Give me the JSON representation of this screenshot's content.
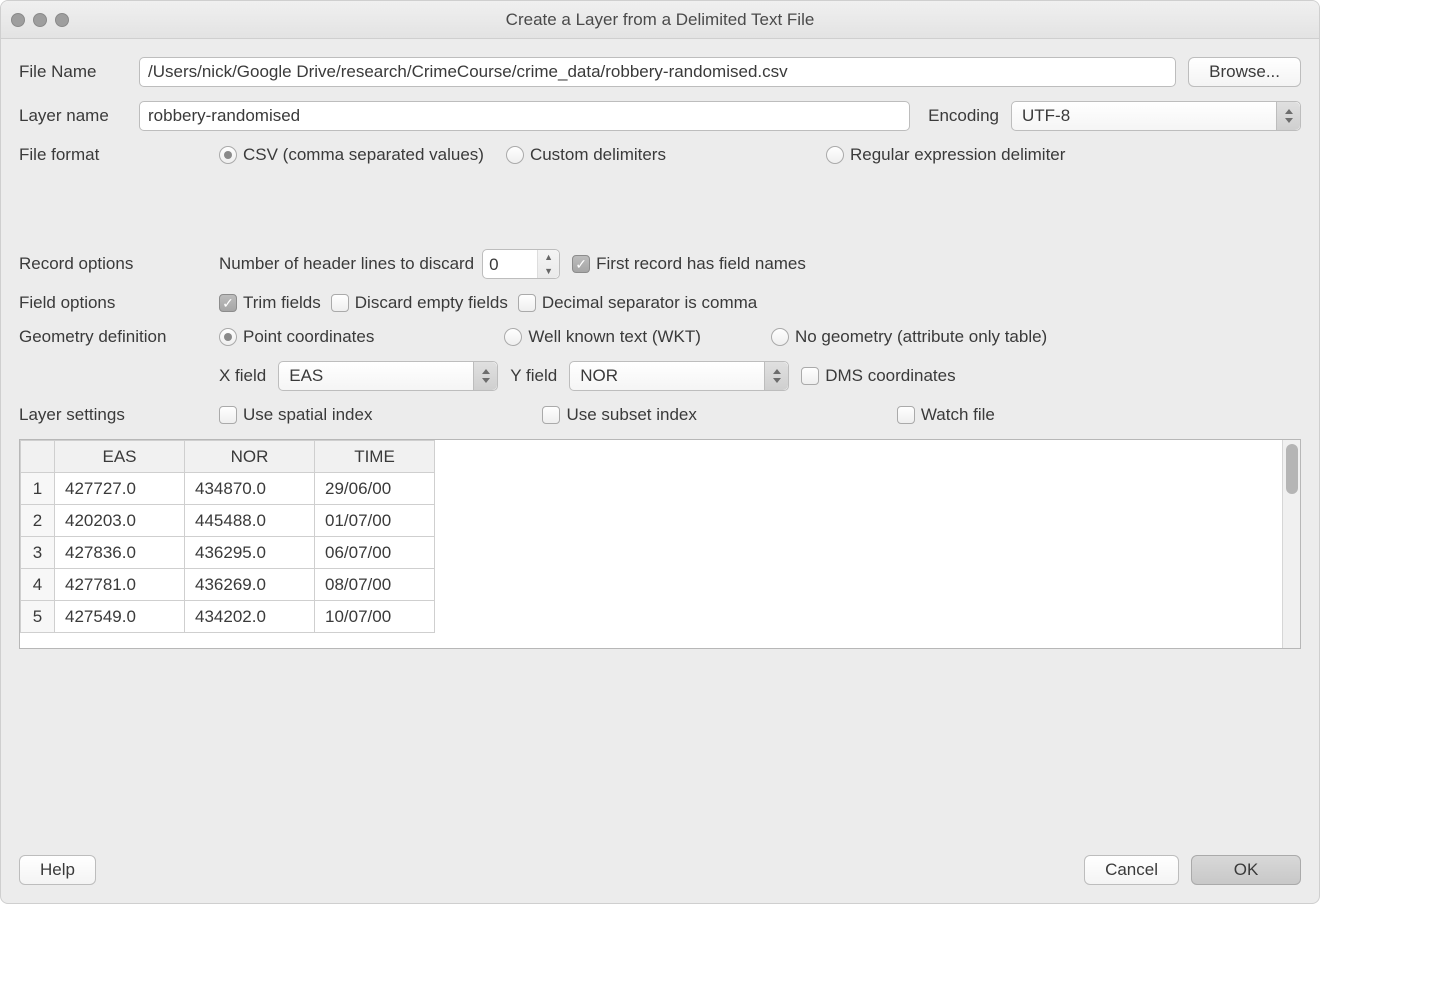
{
  "window_title": "Create a Layer from a Delimited Text File",
  "labels": {
    "file_name": "File Name",
    "layer_name": "Layer name",
    "encoding": "Encoding",
    "file_format": "File format",
    "record_options": "Record options",
    "number_header_discard": "Number of header lines to discard",
    "first_record_has_fields": "First record has field names",
    "field_options": "Field options",
    "trim_fields": "Trim fields",
    "discard_empty": "Discard empty fields",
    "decimal_comma": "Decimal separator is comma",
    "geometry_definition": "Geometry definition",
    "point_coordinates": "Point coordinates",
    "wkt": "Well known text (WKT)",
    "no_geometry": "No geometry (attribute only table)",
    "x_field": "X field",
    "y_field": "Y field",
    "dms": "DMS coordinates",
    "layer_settings": "Layer settings",
    "use_spatial": "Use spatial index",
    "use_subset": "Use subset index",
    "watch_file": "Watch file"
  },
  "file_format": {
    "csv": "CSV (comma separated values)",
    "custom": "Custom delimiters",
    "regex": "Regular expression delimiter"
  },
  "values": {
    "file_name": "/Users/nick/Google Drive/research/CrimeCourse/crime_data/robbery-randomised.csv",
    "layer_name": "robbery-randomised",
    "encoding": "UTF-8",
    "header_discard": "0",
    "x_field": "EAS",
    "y_field": "NOR"
  },
  "buttons": {
    "browse": "Browse...",
    "help": "Help",
    "cancel": "Cancel",
    "ok": "OK"
  },
  "table": {
    "headers": [
      "EAS",
      "NOR",
      "TIME"
    ],
    "rows": [
      {
        "n": "1",
        "eas": "427727.0",
        "nor": "434870.0",
        "time": "29/06/00"
      },
      {
        "n": "2",
        "eas": "420203.0",
        "nor": "445488.0",
        "time": "01/07/00"
      },
      {
        "n": "3",
        "eas": "427836.0",
        "nor": "436295.0",
        "time": "06/07/00"
      },
      {
        "n": "4",
        "eas": "427781.0",
        "nor": "436269.0",
        "time": "08/07/00"
      },
      {
        "n": "5",
        "eas": "427549.0",
        "nor": "434202.0",
        "time": "10/07/00"
      }
    ]
  }
}
